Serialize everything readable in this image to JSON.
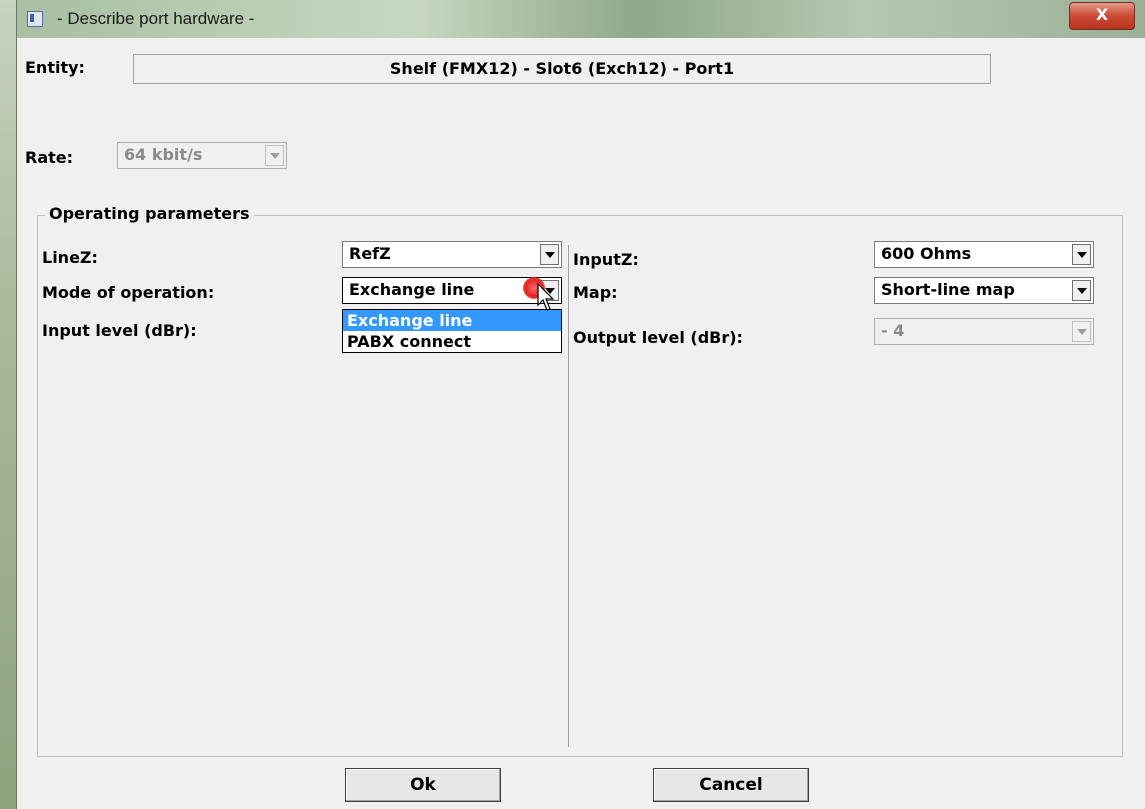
{
  "window": {
    "title": "- Describe port hardware -",
    "close_glyph": "X"
  },
  "entity": {
    "label": "Entity:",
    "value": "Shelf (FMX12) - Slot6 (Exch12) - Port1"
  },
  "rate": {
    "label": "Rate:",
    "value": "64 kbit/s"
  },
  "operating_parameters": {
    "title": "Operating parameters",
    "left": {
      "linez_label": "LineZ:",
      "linez_value": "RefZ",
      "mode_label": "Mode of operation:",
      "mode_value": "Exchange line",
      "input_level_label": "Input level (dBr):",
      "mode_options": [
        "Exchange line",
        "PABX connect"
      ]
    },
    "right": {
      "inputz_label": "InputZ:",
      "inputz_value": "600 Ohms",
      "map_label": "Map:",
      "map_value": "Short-line map",
      "output_level_label": "Output level (dBr):",
      "output_level_value": "- 4"
    }
  },
  "buttons": {
    "ok": "Ok",
    "cancel": "Cancel"
  },
  "colors": {
    "selection": "#3399ff",
    "close_button": "#cc4a35"
  }
}
